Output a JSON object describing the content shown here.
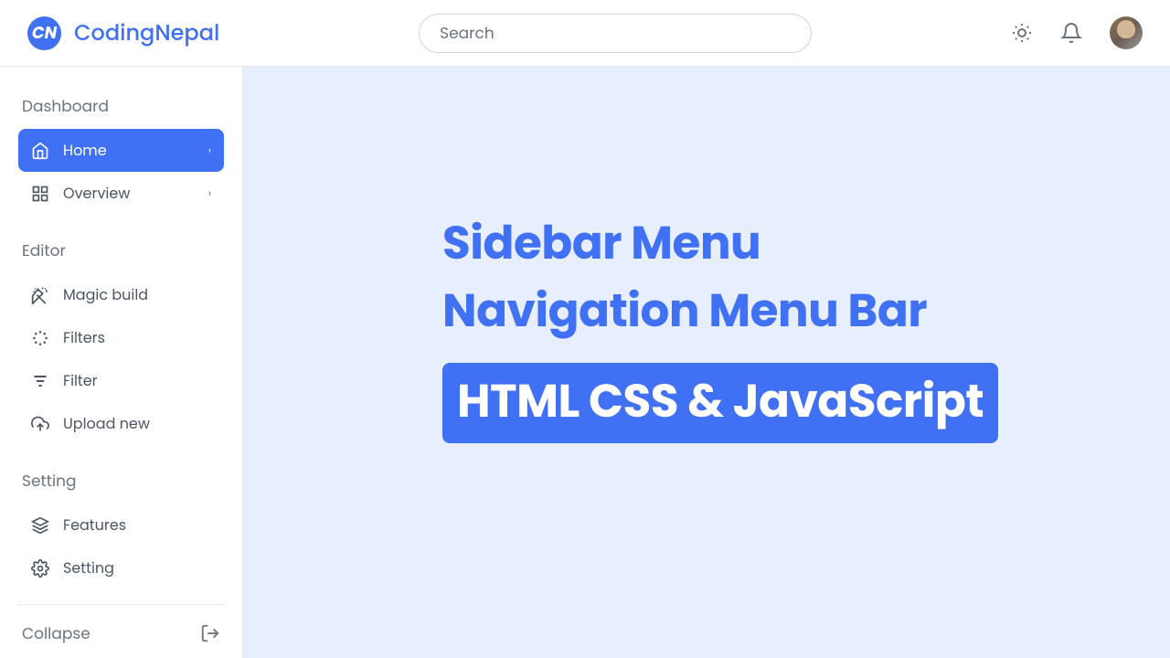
{
  "brand": "CodingNepal",
  "search": {
    "placeholder": "Search"
  },
  "sidebar": {
    "sections": [
      {
        "title": "Dashboard"
      },
      {
        "title": "Editor"
      },
      {
        "title": "Setting"
      }
    ],
    "items": {
      "home": "Home",
      "overview": "Overview",
      "magic_build": "Magic build",
      "filters": "Filters",
      "filter": "Filter",
      "upload_new": "Upload new",
      "features": "Features",
      "setting": "Setting"
    },
    "collapse": "Collapse"
  },
  "hero": {
    "line1": "Sidebar Menu",
    "line2": "Navigation Menu Bar",
    "badge": "HTML CSS & JavaScript"
  }
}
